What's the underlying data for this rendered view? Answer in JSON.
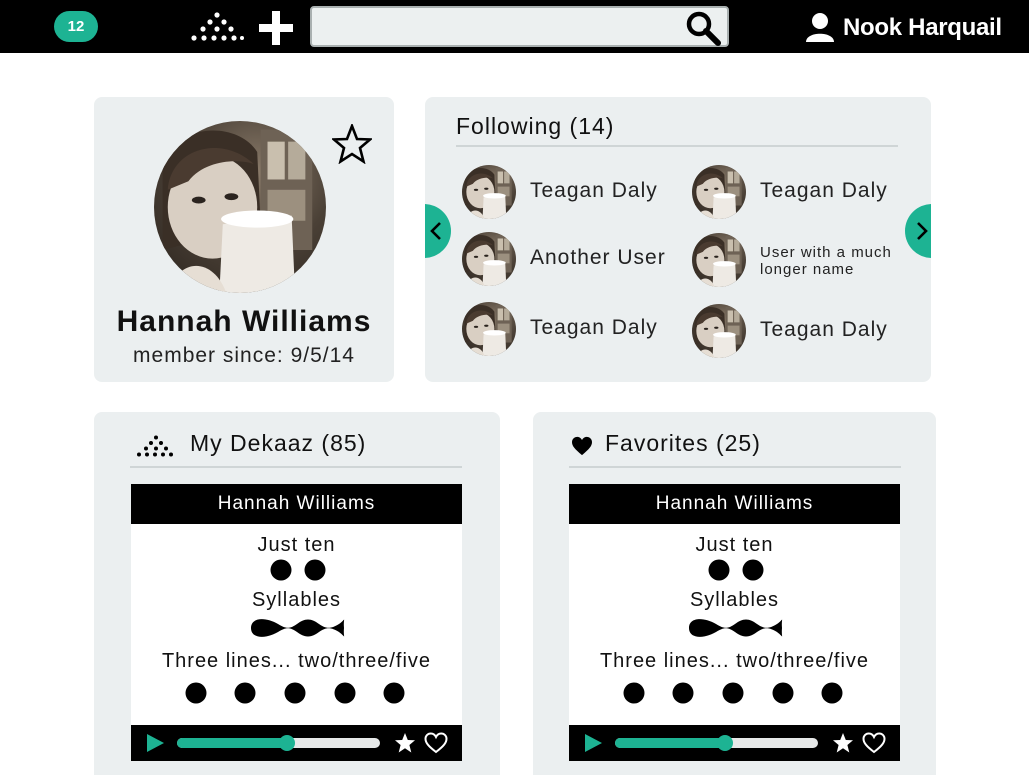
{
  "topbar": {
    "badge_count": "12",
    "search": {
      "value": "",
      "placeholder": ""
    },
    "username": "Nook Harquail"
  },
  "profile": {
    "name": "Hannah Williams",
    "member_since": "member since: 9/5/14"
  },
  "following": {
    "title": "Following (14)",
    "users": [
      {
        "name": "Teagan Daly"
      },
      {
        "name": "Teagan Daly"
      },
      {
        "name": "Another User"
      },
      {
        "name": "User with a much longer name"
      },
      {
        "name": "Teagan Daly"
      },
      {
        "name": "Teagan Daly"
      }
    ]
  },
  "dekaaz": {
    "title": "My Dekaaz (85)",
    "poem": {
      "author": "Hannah Williams",
      "lines": [
        "Just ten",
        "Syllables",
        "Three lines... two/three/five"
      ],
      "progress": 0.54
    }
  },
  "favorites": {
    "title": "Favorites (25)",
    "poem": {
      "author": "Hannah Williams",
      "lines": [
        "Just ten",
        "Syllables",
        "Three lines... two/three/five"
      ],
      "progress": 0.54
    }
  },
  "colors": {
    "accent": "#1db393",
    "topbar": "#000000",
    "card": "#ebeff0"
  },
  "icons": [
    "dekaaz-logo-icon",
    "plus-icon",
    "search-icon",
    "user-icon",
    "star-outline-icon",
    "chevron-left-icon",
    "chevron-right-icon",
    "heart-icon",
    "play-icon",
    "star-icon",
    "heart-outline-icon"
  ]
}
